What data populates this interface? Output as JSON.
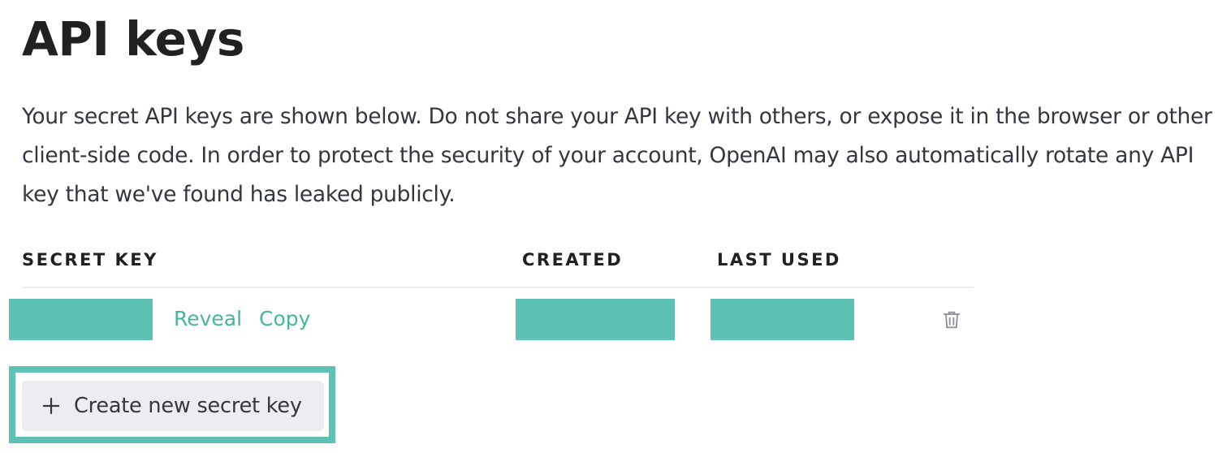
{
  "page": {
    "title": "API keys",
    "description": "Your secret API keys are shown below. Do not share your API key with others, or expose it in the browser or other client-side code. In order to protect the security of your account, OpenAI may also automatically rotate any API key that we've found has leaked publicly."
  },
  "table": {
    "columns": [
      "SECRET KEY",
      "CREATED",
      "LAST USED"
    ],
    "rows": [
      {
        "secret_key": "",
        "created": "",
        "last_used": "",
        "actions": {
          "reveal_label": "Reveal",
          "copy_label": "Copy",
          "delete_icon": "trash-icon"
        }
      }
    ]
  },
  "actions": {
    "create_label": "Create new secret key",
    "create_icon": "plus-icon"
  },
  "colors": {
    "link": "#10a37f",
    "redaction": "#5ec1b6",
    "button_bg": "#ececf1",
    "heading": "#202123"
  }
}
